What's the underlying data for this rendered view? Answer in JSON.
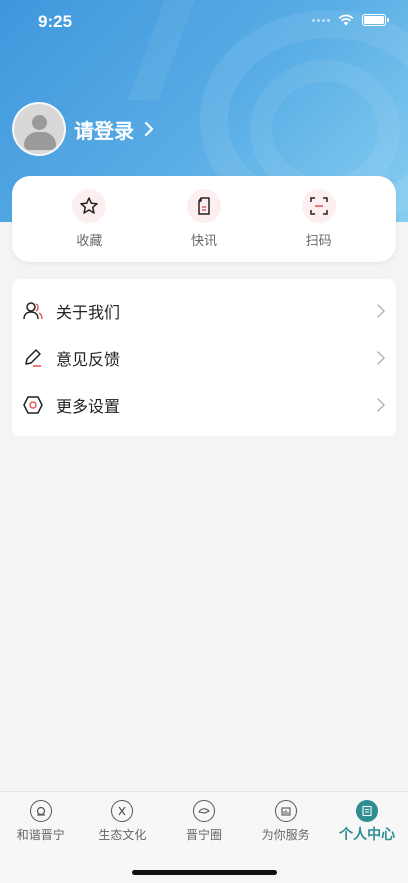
{
  "status_bar": {
    "time": "9:25"
  },
  "profile": {
    "login_text": "请登录"
  },
  "quick_actions": [
    {
      "label": "收藏",
      "icon": "star-icon"
    },
    {
      "label": "快讯",
      "icon": "document-icon"
    },
    {
      "label": "扫码",
      "icon": "scan-icon"
    }
  ],
  "menu": [
    {
      "label": "关于我们",
      "icon": "users-icon"
    },
    {
      "label": "意见反馈",
      "icon": "pencil-icon"
    },
    {
      "label": "更多设置",
      "icon": "settings-hexagon-icon"
    }
  ],
  "tabbar": [
    {
      "label": "和谐晋宁",
      "icon": "harmony-icon",
      "active": false
    },
    {
      "label": "生态文化",
      "icon": "ecology-icon",
      "active": false
    },
    {
      "label": "晋宁圈",
      "icon": "circle-community-icon",
      "active": false
    },
    {
      "label": "为你服务",
      "icon": "service-icon",
      "active": false
    },
    {
      "label": "个人中心",
      "icon": "profile-center-icon",
      "active": true
    }
  ],
  "colors": {
    "header_gradient_start": "#3f97dc",
    "header_gradient_end": "#86cdf0",
    "accent": "#2f8e92",
    "icon_red": "#e05a5a"
  }
}
